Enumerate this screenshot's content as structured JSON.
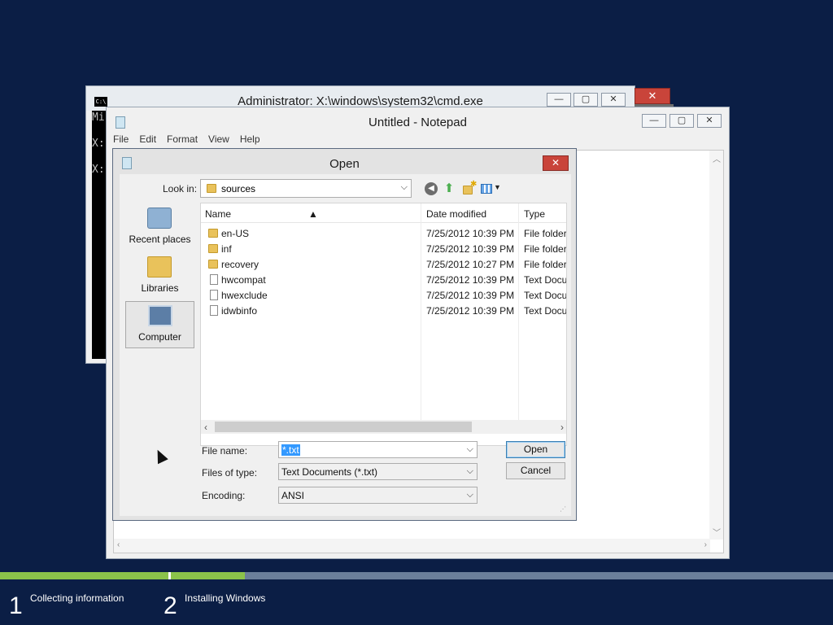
{
  "cmd": {
    "title": "Administrator: X:\\windows\\system32\\cmd.exe",
    "icon_text": "C:\\",
    "console_lines": [
      "Mi",
      "X:",
      "X:"
    ],
    "close_glyph": "✕"
  },
  "notepad": {
    "title": "Untitled - Notepad",
    "menu": [
      "File",
      "Edit",
      "Format",
      "View",
      "Help"
    ]
  },
  "window_buttons": {
    "minimize": "—",
    "maximize": "▢",
    "close": "✕"
  },
  "dialog": {
    "title": "Open",
    "close_glyph": "✕",
    "look_in_label": "Look in:",
    "look_in_value": "sources",
    "places": [
      "Recent places",
      "Libraries",
      "Computer"
    ],
    "columns": {
      "name": "Name",
      "date": "Date modified",
      "type": "Type"
    },
    "files": [
      {
        "name": "en-US",
        "date": "7/25/2012 10:39 PM",
        "type": "File folder",
        "kind": "folder"
      },
      {
        "name": "inf",
        "date": "7/25/2012 10:39 PM",
        "type": "File folder",
        "kind": "folder"
      },
      {
        "name": "recovery",
        "date": "7/25/2012 10:27 PM",
        "type": "File folder",
        "kind": "folder"
      },
      {
        "name": "hwcompat",
        "date": "7/25/2012 10:39 PM",
        "type": "Text Docu",
        "kind": "doc"
      },
      {
        "name": "hwexclude",
        "date": "7/25/2012 10:39 PM",
        "type": "Text Docu",
        "kind": "doc"
      },
      {
        "name": "idwbinfo",
        "date": "7/25/2012 10:39 PM",
        "type": "Text Docu",
        "kind": "doc"
      }
    ],
    "file_name_label": "File name:",
    "file_name_value": "*.txt",
    "files_of_type_label": "Files of type:",
    "files_of_type_value": "Text Documents (*.txt)",
    "encoding_label": "Encoding:",
    "encoding_value": "ANSI",
    "open_button": "Open",
    "cancel_button": "Cancel"
  },
  "setup": {
    "steps": [
      {
        "number": "1",
        "label": "Collecting information"
      },
      {
        "number": "2",
        "label": "Installing Windows"
      }
    ],
    "colors": {
      "background": "#0b1e45",
      "progress": "#8bc34a",
      "track": "#6b7f9a"
    }
  }
}
